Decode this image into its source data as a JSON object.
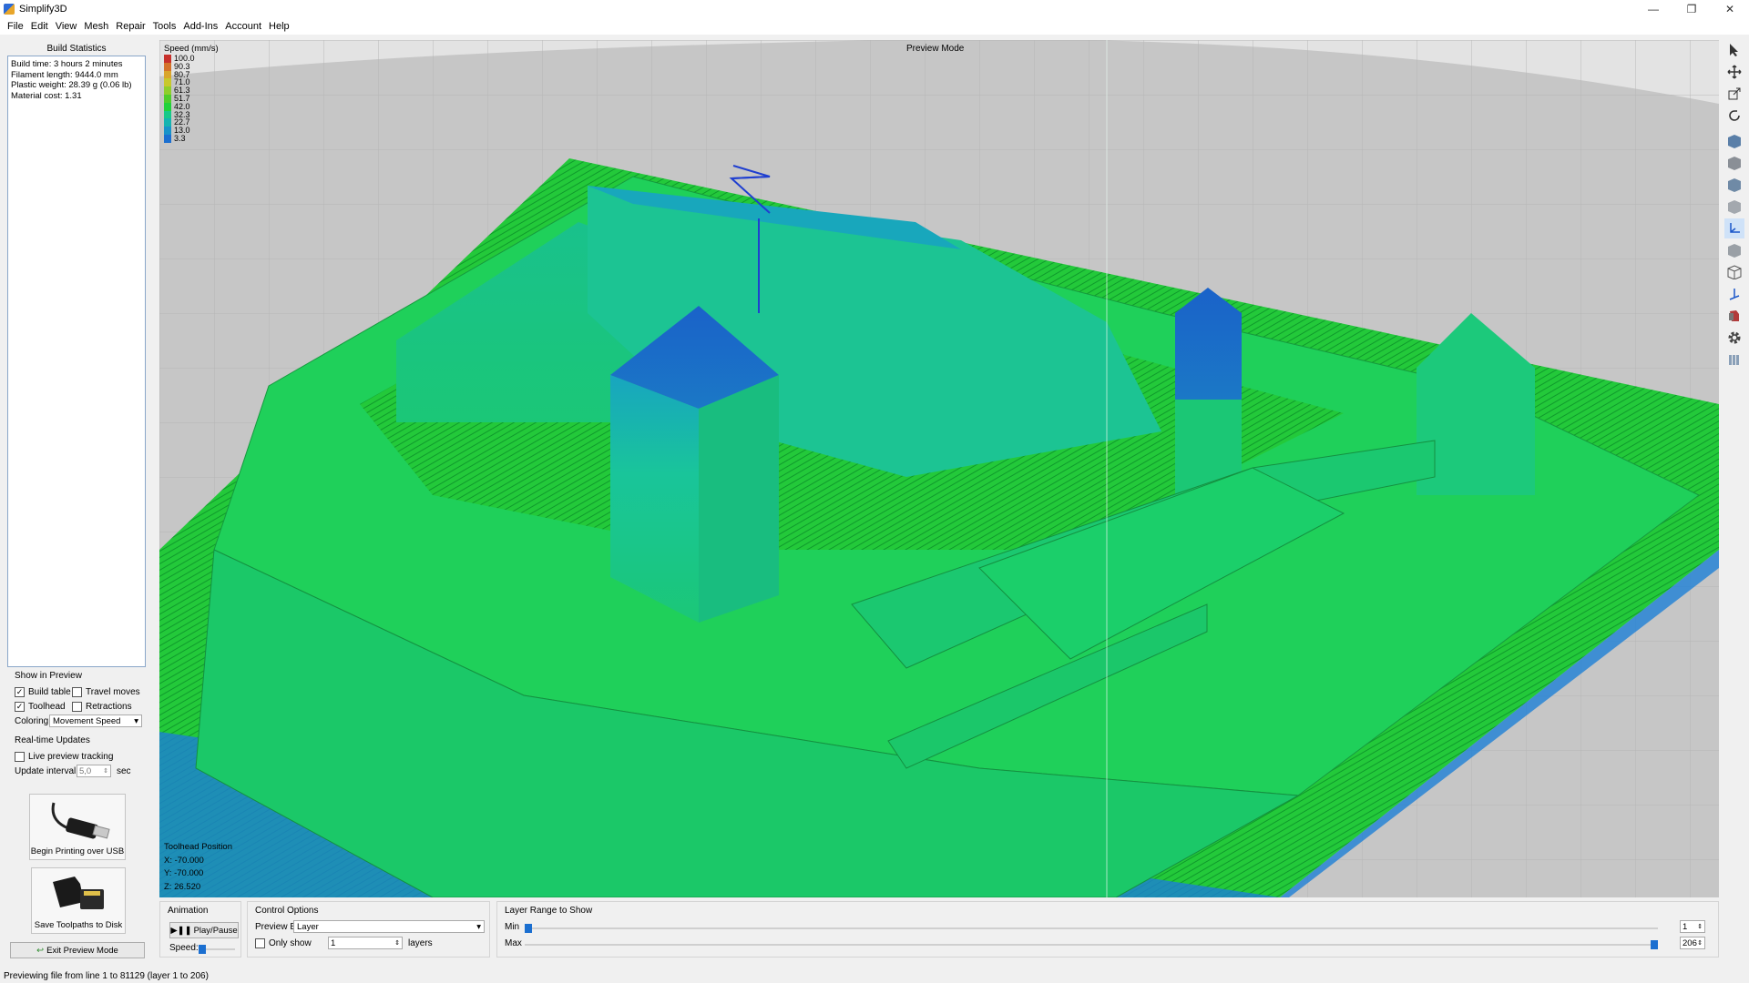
{
  "window": {
    "title": "Simplify3D",
    "min": "—",
    "restore": "❐",
    "close": "✕"
  },
  "menu": [
    "File",
    "Edit",
    "View",
    "Mesh",
    "Repair",
    "Tools",
    "Add-Ins",
    "Account",
    "Help"
  ],
  "stats": {
    "title": "Build Statistics",
    "lines": [
      "Build time: 3 hours 2 minutes",
      "Filament length: 9444.0 mm",
      "Plastic weight: 28.39 g (0.06 lb)",
      "Material cost: 1.31"
    ]
  },
  "show_in_preview": {
    "title": "Show in Preview",
    "build_table": {
      "label": "Build table",
      "checked": true
    },
    "travel_moves": {
      "label": "Travel moves",
      "checked": false
    },
    "toolhead": {
      "label": "Toolhead",
      "checked": true
    },
    "retractions": {
      "label": "Retractions",
      "checked": false
    },
    "coloring_label": "Coloring",
    "coloring_value": "Movement Speed"
  },
  "realtime": {
    "title": "Real-time Updates",
    "live_label": "Live preview tracking",
    "interval_label": "Update interval",
    "interval_value": "5,0",
    "interval_unit": "sec"
  },
  "buttons": {
    "usb": "Begin Printing over USB",
    "disk": "Save Toolpaths to Disk",
    "exit": "Exit Preview Mode",
    "play": "Play/Pause"
  },
  "viewport": {
    "mode": "Preview Mode",
    "legend_title": "Speed (mm/s)",
    "legend": [
      {
        "value": "100.0",
        "color": "#c7302b"
      },
      {
        "value": "90.3",
        "color": "#d4722a"
      },
      {
        "value": "80.7",
        "color": "#d9a52c"
      },
      {
        "value": "71.0",
        "color": "#c8c82c"
      },
      {
        "value": "61.3",
        "color": "#8fce2c"
      },
      {
        "value": "51.7",
        "color": "#4fcd2c"
      },
      {
        "value": "42.0",
        "color": "#21d23a"
      },
      {
        "value": "32.3",
        "color": "#17c989"
      },
      {
        "value": "22.7",
        "color": "#14b4b0"
      },
      {
        "value": "13.0",
        "color": "#1893c9"
      },
      {
        "value": "3.3",
        "color": "#1b6fd0"
      }
    ],
    "toolhead_title": "Toolhead Position",
    "toolhead_x": "X: -70.000",
    "toolhead_y": "Y: -70.000",
    "toolhead_z": "Z: 26.520"
  },
  "animation": {
    "title": "Animation",
    "speed_label": "Speed:"
  },
  "control": {
    "title": "Control Options",
    "preview_by_label": "Preview By",
    "preview_by_value": "Layer",
    "only_show_label": "Only show",
    "only_show_value": "1",
    "layers_label": "layers"
  },
  "layer_range": {
    "title": "Layer Range to Show",
    "min_label": "Min",
    "max_label": "Max",
    "min_value": "1",
    "max_value": "206",
    "total_layers": 206
  },
  "status": "Previewing file from line 1 to 81129 (layer 1 to 206)",
  "right_tools": [
    "select-icon",
    "move-icon",
    "scale-icon",
    "rotate-icon",
    "view-top-icon",
    "view-front-icon",
    "view-side-icon",
    "view-iso-icon",
    "axes-icon",
    "solid-view-icon",
    "wireframe-icon",
    "cross-section-icon",
    "tools-icon",
    "settings-gear-icon",
    "layers-icon"
  ]
}
